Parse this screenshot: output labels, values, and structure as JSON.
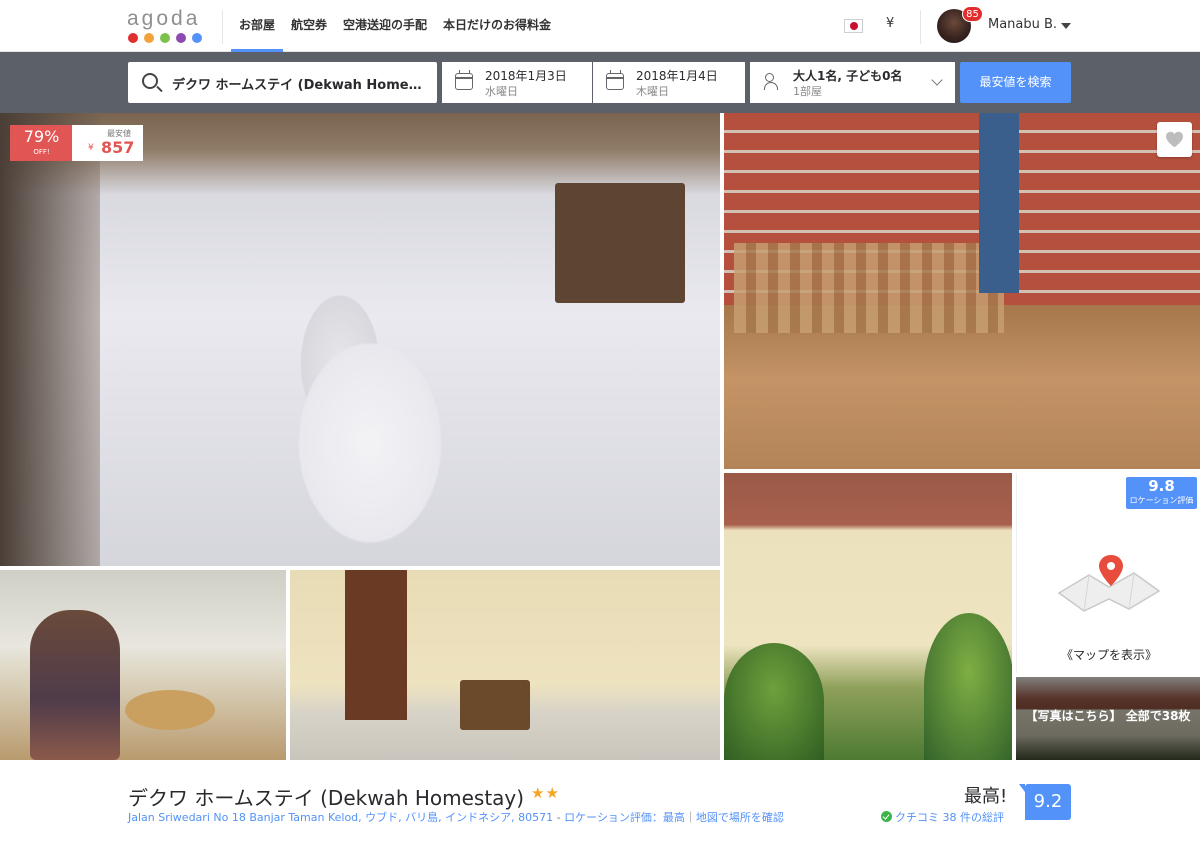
{
  "brand": {
    "logo_text": "agoda",
    "dot_colors": [
      "#e02d2d",
      "#f1a23a",
      "#7cc04b",
      "#8b4bb3",
      "#5392f9"
    ]
  },
  "nav": {
    "links": [
      "お部屋",
      "航空券",
      "空港送迎の手配",
      "本日だけのお得料金"
    ],
    "active_index": 0,
    "currency": "¥",
    "notification_count": "85",
    "user_name": "Manabu B."
  },
  "search": {
    "destination": "デクワ ホームステイ (Dekwah Homestay)",
    "checkin": {
      "date": "2018年1月3日",
      "weekday": "水曜日"
    },
    "checkout": {
      "date": "2018年1月4日",
      "weekday": "木曜日"
    },
    "occupancy": {
      "guests": "大人1名, 子ども0名",
      "rooms": "1部屋"
    },
    "button_label": "最安値を検索"
  },
  "gallery": {
    "discount_pct": "79%",
    "discount_off": "OFF!",
    "price_label": "最安値",
    "price_currency": "¥",
    "price_value": "857",
    "location_score": "9.8",
    "location_label": "ロケーション評価",
    "map_link": "《マップを表示》",
    "photos_caption": "【写真はこちら】 全部で38枚"
  },
  "hotel": {
    "name": "デクワ ホームステイ (Dekwah Homestay)",
    "stars": "★★",
    "star_count": 2,
    "address": "Jalan Sriwedari No 18 Banjar Taman Kelod, ウブド, バリ島, インドネシア, 80571",
    "address_sep": " - ",
    "location_link": "ロケーション評価：最高",
    "link_sep": "｜",
    "map_link": "地図で場所を確認",
    "rating_word": "最高!",
    "review_text": "クチコミ 38 件の総評",
    "score": "9.2"
  },
  "colors": {
    "accent": "#5392f9",
    "discount": "#e15555",
    "star": "#f5a623",
    "searchbar_bg": "#5c6069"
  }
}
